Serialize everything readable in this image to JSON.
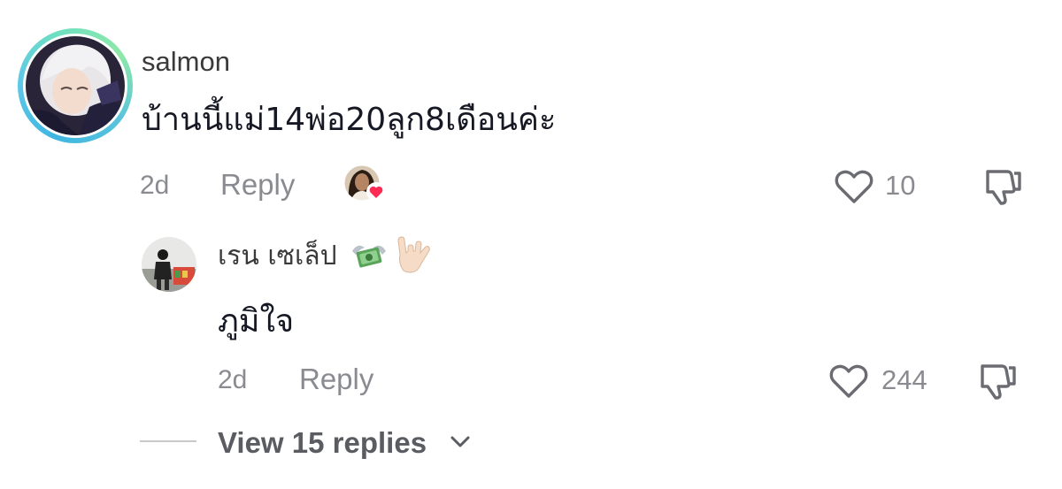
{
  "main_comment": {
    "username": "salmon",
    "text": "บ้านนี้แม่14พ่อ20ลูก8เดือนค่ะ",
    "time": "2d",
    "reply_label": "Reply",
    "like_count": "10",
    "liked_by_creator": true
  },
  "reply_comment": {
    "username": "เรน เซเล็ป",
    "username_emojis": [
      "money-with-wings-icon",
      "love-you-gesture-icon"
    ],
    "text": "ภูมิใจ",
    "time": "2d",
    "reply_label": "Reply",
    "like_count": "244"
  },
  "view_replies": {
    "label": "View 15 replies"
  },
  "colors": {
    "text_primary": "#161823",
    "text_secondary": "#8a8b91",
    "heart_badge": "#fe2c55",
    "avatar_ring_start": "#3fb6e0",
    "avatar_ring_end": "#8ee8a8"
  }
}
